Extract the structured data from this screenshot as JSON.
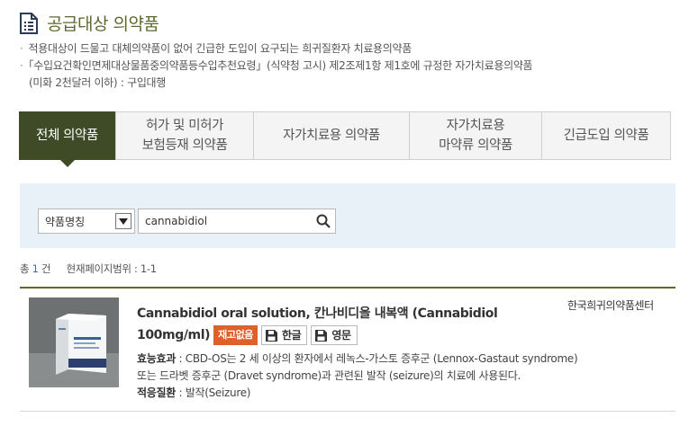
{
  "page": {
    "title": "공급대상 의약품",
    "notes": [
      "적용대상이 드물고 대체의약품이 없어 긴급한 도입이 요구되는 희귀질환자 치료용의약품",
      "「수입요건확인면제대상물품중의약품등수입추천요령」(식약청 고시) 제2조제1항 제1호에 규정한 자가치료용의약품"
    ],
    "note_continuation": "(미화 2천달러 이하) : 구입대행"
  },
  "tabs": [
    {
      "line1": "전체 의약품",
      "line2": ""
    },
    {
      "line1": "허가 및 미허가",
      "line2": "보험등재 의약품"
    },
    {
      "line1": "자가치료용 의약품",
      "line2": ""
    },
    {
      "line1": "자가치료용",
      "line2": "마약류 의약품"
    },
    {
      "line1": "긴급도입 의약품",
      "line2": ""
    }
  ],
  "search": {
    "category_selected": "약품명칭",
    "query": "cannabidiol"
  },
  "results_info": {
    "total_prefix": "총",
    "total_count": "1",
    "total_suffix": "건",
    "range_label": "현재페이지범위 : 1-1"
  },
  "result": {
    "name_line1": "Cannabidiol oral solution, 칸나비디올 내복액 (Cannabidiol",
    "name_line2": "100mg/ml)",
    "stock_badge": "재고없음",
    "btn_korean": "한글",
    "btn_english": "영문",
    "organization": "한국희귀의약품센터",
    "efficacy_label": "효능효과",
    "efficacy_text": " : CBD-OS는 2 세 이상의 환자에서 레녹스-가스토 증후군 (Lennox-Gastaut syndrome)",
    "efficacy_text2": "또는 드라벳 증후군 (Dravet syndrome)과 관련된 발작 (seizure)의 치료에 사용된다.",
    "indication_label": "적응질환",
    "indication_text": " : 발작(Seizure)"
  },
  "colors": {
    "accent_olive": "#5d6a2d",
    "active_tab": "#3f4a26",
    "badge_orange": "#e0602c",
    "search_bg": "#e9f1f8"
  }
}
